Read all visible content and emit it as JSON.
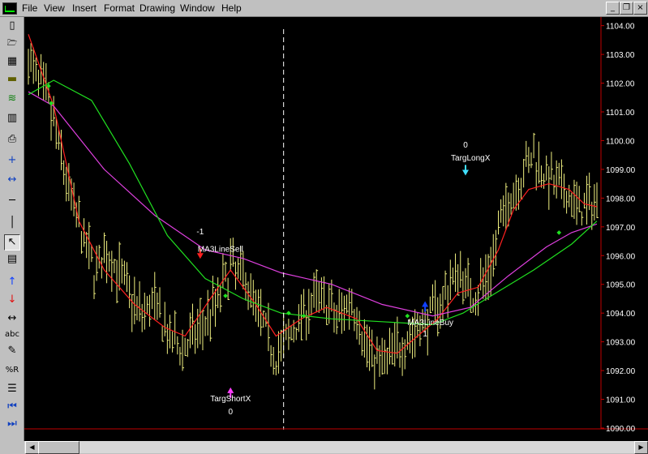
{
  "menu": [
    "File",
    "View",
    "Insert",
    "Format",
    "Drawing",
    "Window",
    "Help"
  ],
  "window_buttons": [
    "_",
    "❐",
    "×"
  ],
  "toolbar": [
    {
      "icon": "new-document-icon",
      "glyph": "▯"
    },
    {
      "icon": "open-folder-icon",
      "glyph": "🗁"
    },
    {
      "icon": "windows-stack-icon",
      "glyph": "▦"
    },
    {
      "icon": "folder-chart-icon",
      "glyph": "▬"
    },
    {
      "icon": "scanner-icon",
      "glyph": "≋"
    },
    {
      "icon": "chart-window-icon",
      "glyph": "▥"
    },
    {
      "icon": "printer-icon",
      "glyph": "⎙"
    },
    {
      "icon": "zoom-in-icon",
      "glyph": "+"
    },
    {
      "icon": "zoom-out-icon",
      "glyph": "↔"
    },
    {
      "icon": "horizontal-line-icon",
      "glyph": "─"
    },
    {
      "icon": "vertical-line-icon",
      "glyph": "│"
    },
    {
      "icon": "pointer-icon",
      "glyph": "↖"
    },
    {
      "icon": "note-icon",
      "glyph": "▤"
    },
    {
      "icon": "buy-arrow-icon",
      "glyph": "↑"
    },
    {
      "icon": "sell-arrow-icon",
      "glyph": "↓"
    },
    {
      "icon": "horizontal-arrow-icon",
      "glyph": "↔"
    },
    {
      "icon": "text-icon",
      "glyph": "abc"
    },
    {
      "icon": "pencil-icon",
      "glyph": "✎"
    },
    {
      "icon": "percent-r-icon",
      "glyph": "%R"
    },
    {
      "icon": "fibonacci-lines-icon",
      "glyph": "☰"
    },
    {
      "icon": "go-first-icon",
      "glyph": "⏮"
    },
    {
      "icon": "go-last-icon",
      "glyph": "⏭"
    }
  ],
  "colors": {
    "background": "#000000",
    "bars": "#f0f080",
    "ma_fast": "#ff2020",
    "ma_mid": "#e040e0",
    "ma_slow": "#20e020",
    "axis": "#c00000",
    "label_text": "#ffffff",
    "buy_marker": "#1040ff",
    "sell_marker": "#ff2020",
    "targ_short_marker": "#ff40ff",
    "targ_long_marker": "#40e0ff"
  },
  "chart_data": {
    "type": "line",
    "ylim": [
      1090.0,
      1104.3
    ],
    "y_ticks": [
      "1104.00",
      "1103.00",
      "1102.00",
      "1101.00",
      "1100.00",
      "1099.00",
      "1098.00",
      "1097.00",
      "1096.00",
      "1095.00",
      "1094.00",
      "1093.00",
      "1092.00",
      "1091.00",
      "1090.00"
    ],
    "y_tick_values": [
      1104,
      1103,
      1102,
      1101,
      1100,
      1099,
      1098,
      1097,
      1096,
      1095,
      1094,
      1093,
      1092,
      1091,
      1090
    ],
    "bar_count": 226,
    "price_anchors": [
      [
        0,
        1102.8
      ],
      [
        8,
        1101.3
      ],
      [
        14,
        1099.0
      ],
      [
        20,
        1097.0
      ],
      [
        26,
        1095.5
      ],
      [
        32,
        1096.0
      ],
      [
        38,
        1095.0
      ],
      [
        44,
        1094.0
      ],
      [
        50,
        1094.3
      ],
      [
        56,
        1093.0
      ],
      [
        62,
        1092.8
      ],
      [
        68,
        1093.5
      ],
      [
        74,
        1094.3
      ],
      [
        80,
        1095.6
      ],
      [
        86,
        1095.2
      ],
      [
        92,
        1093.8
      ],
      [
        98,
        1092.5
      ],
      [
        104,
        1093.3
      ],
      [
        110,
        1094.2
      ],
      [
        116,
        1094.6
      ],
      [
        122,
        1093.8
      ],
      [
        128,
        1094.5
      ],
      [
        134,
        1092.8
      ],
      [
        140,
        1092.2
      ],
      [
        146,
        1092.8
      ],
      [
        152,
        1093.3
      ],
      [
        158,
        1093.8
      ],
      [
        164,
        1094.5
      ],
      [
        170,
        1095.5
      ],
      [
        176,
        1094.6
      ],
      [
        182,
        1095.3
      ],
      [
        188,
        1097.5
      ],
      [
        194,
        1098.6
      ],
      [
        200,
        1099.5
      ],
      [
        206,
        1098.6
      ],
      [
        212,
        1098.2
      ],
      [
        218,
        1097.6
      ],
      [
        225,
        1097.9
      ]
    ],
    "series": [
      {
        "key": "ma_fast",
        "points": [
          [
            0,
            1103.7
          ],
          [
            10,
            1101.2
          ],
          [
            20,
            1097.2
          ],
          [
            30,
            1095.5
          ],
          [
            42,
            1094.3
          ],
          [
            54,
            1093.5
          ],
          [
            62,
            1093.2
          ],
          [
            72,
            1094.5
          ],
          [
            80,
            1095.5
          ],
          [
            90,
            1094.3
          ],
          [
            98,
            1093.2
          ],
          [
            108,
            1093.8
          ],
          [
            118,
            1094.2
          ],
          [
            124,
            1094.0
          ],
          [
            130,
            1093.8
          ],
          [
            138,
            1092.7
          ],
          [
            146,
            1092.6
          ],
          [
            154,
            1093.2
          ],
          [
            162,
            1093.8
          ],
          [
            170,
            1094.7
          ],
          [
            178,
            1094.9
          ],
          [
            186,
            1096.2
          ],
          [
            192,
            1097.6
          ],
          [
            198,
            1098.3
          ],
          [
            206,
            1098.5
          ],
          [
            214,
            1098.3
          ],
          [
            220,
            1097.8
          ],
          [
            225,
            1097.7
          ]
        ]
      },
      {
        "key": "ma_mid",
        "points": [
          [
            0,
            1101.7
          ],
          [
            10,
            1101.2
          ],
          [
            30,
            1099.0
          ],
          [
            50,
            1097.4
          ],
          [
            70,
            1096.2
          ],
          [
            85,
            1095.9
          ],
          [
            100,
            1095.4
          ],
          [
            120,
            1095.0
          ],
          [
            140,
            1094.3
          ],
          [
            160,
            1093.9
          ],
          [
            175,
            1094.2
          ],
          [
            190,
            1095.3
          ],
          [
            205,
            1096.3
          ],
          [
            215,
            1096.8
          ],
          [
            225,
            1097.1
          ]
        ]
      },
      {
        "key": "ma_slow",
        "points": [
          [
            0,
            1101.6
          ],
          [
            10,
            1102.1
          ],
          [
            25,
            1101.4
          ],
          [
            40,
            1099.2
          ],
          [
            55,
            1096.7
          ],
          [
            70,
            1095.2
          ],
          [
            85,
            1094.5
          ],
          [
            100,
            1094.0
          ],
          [
            120,
            1093.8
          ],
          [
            140,
            1093.7
          ],
          [
            160,
            1093.6
          ],
          [
            172,
            1094.0
          ],
          [
            185,
            1094.7
          ],
          [
            200,
            1095.5
          ],
          [
            215,
            1096.4
          ],
          [
            225,
            1097.2
          ]
        ]
      }
    ],
    "cursor_x": 101,
    "annotations": [
      {
        "name": "ma3linesell-label",
        "text": "MA3LineSell",
        "x": 67,
        "y": 1096.0,
        "anchor": "start",
        "dy": -5
      },
      {
        "name": "sell-position-label",
        "text": "-1",
        "x": 68,
        "y": 1096.4,
        "anchor": "middle",
        "dy": -12
      },
      {
        "name": "ma3linebuy-label",
        "text": "MA3LineBuy",
        "x": 150,
        "y": 1093.7,
        "anchor": "start",
        "dy": 4
      },
      {
        "name": "buy-position-label",
        "text": "1",
        "x": 157,
        "y": 1093.7,
        "anchor": "middle",
        "dy": 18
      },
      {
        "name": "targshortx-label",
        "text": "TargShortX",
        "x": 80,
        "y": 1091.5,
        "anchor": "middle",
        "dy": 20
      },
      {
        "name": "short-position-label",
        "text": "0",
        "x": 80,
        "y": 1091.5,
        "anchor": "middle",
        "dy": 36
      },
      {
        "name": "targlongx-label",
        "text": "TargLongX",
        "x": 175,
        "y": 1099.2,
        "anchor": "middle",
        "dy": -4
      },
      {
        "name": "long-position-label",
        "text": "0",
        "x": 173,
        "y": 1099.2,
        "anchor": "middle",
        "dy": -20
      }
    ],
    "markers": [
      {
        "name": "sell-signal-arrow",
        "kind": "sell",
        "x": 68,
        "y": 1096.0
      },
      {
        "name": "buy-signal-arrow",
        "kind": "buy",
        "x": 157,
        "y": 1094.3
      },
      {
        "name": "targ-short-arrow",
        "kind": "targ_short",
        "x": 80,
        "y": 1091.3
      },
      {
        "name": "targ-long-arrow",
        "kind": "targ_long",
        "x": 173,
        "y": 1098.9
      }
    ],
    "cross_dots": [
      [
        8,
        1101.9
      ],
      [
        9,
        1101.3
      ],
      [
        78,
        1094.6
      ],
      [
        103,
        1094.0
      ],
      [
        109,
        1093.9
      ],
      [
        150,
        1093.9
      ],
      [
        210,
        1096.8
      ]
    ]
  }
}
